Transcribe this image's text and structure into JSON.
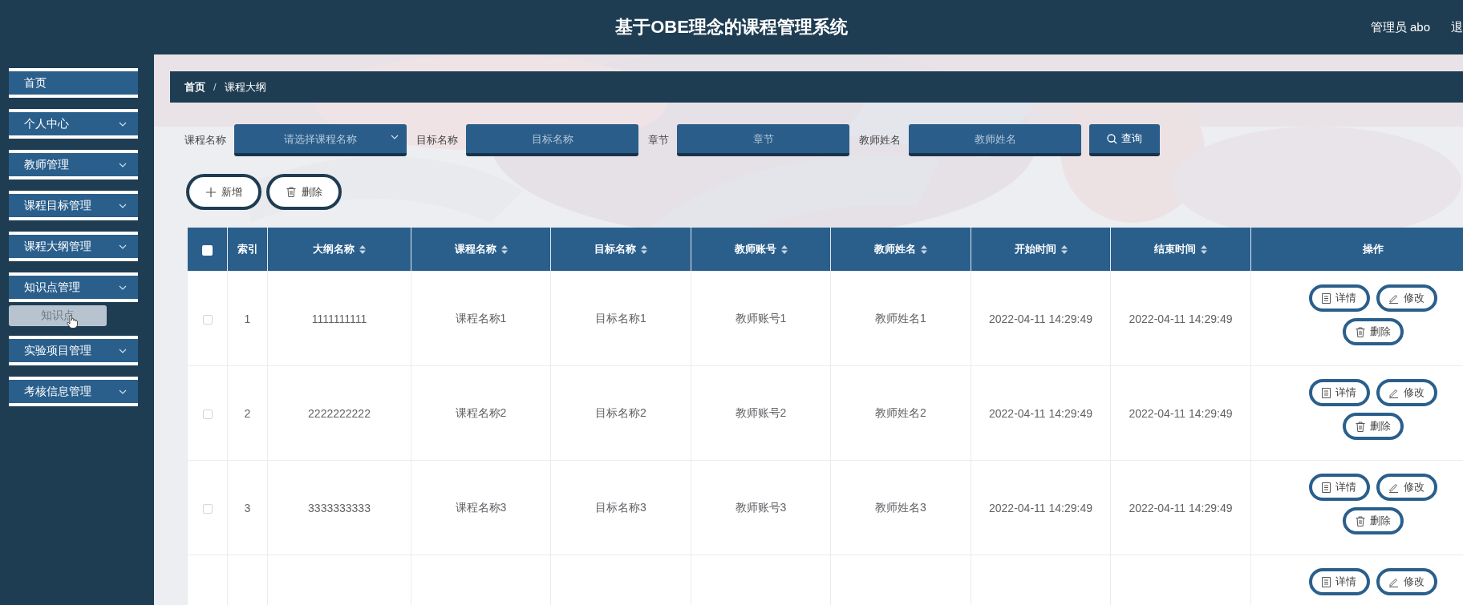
{
  "header": {
    "title": "基于OBE理念的课程管理系统",
    "user": "管理员 abo",
    "logout": "退"
  },
  "sidebar": {
    "items": [
      {
        "label": "首页",
        "kind": "link"
      },
      {
        "label": "个人中心",
        "kind": "menu"
      },
      {
        "label": "教师管理",
        "kind": "menu"
      },
      {
        "label": "课程目标管理",
        "kind": "menu"
      },
      {
        "label": "课程大纲管理",
        "kind": "menu"
      },
      {
        "label": "知识点管理",
        "kind": "menu",
        "children": [
          {
            "label": "知识点"
          }
        ]
      },
      {
        "label": "实验项目管理",
        "kind": "menu"
      },
      {
        "label": "考核信息管理",
        "kind": "menu"
      }
    ]
  },
  "breadcrumb": {
    "items": [
      "首页",
      "课程大纲"
    ],
    "separator": "/"
  },
  "search": {
    "fields": [
      {
        "label": "课程名称",
        "kind": "select",
        "placeholder": "请选择课程名称"
      },
      {
        "label": "目标名称",
        "kind": "input",
        "placeholder": "目标名称"
      },
      {
        "label": "章节",
        "kind": "input",
        "placeholder": "章节"
      },
      {
        "label": "教师姓名",
        "kind": "input",
        "placeholder": "教师姓名"
      }
    ],
    "button": "查询"
  },
  "actions": [
    {
      "label": "新增",
      "kind": "add"
    },
    {
      "label": "删除",
      "kind": "delete"
    }
  ],
  "table": {
    "header_checked": false,
    "columns": [
      {
        "label": "索引",
        "sortable": false
      },
      {
        "label": "大纲名称",
        "sortable": true
      },
      {
        "label": "课程名称",
        "sortable": true
      },
      {
        "label": "目标名称",
        "sortable": true
      },
      {
        "label": "教师账号",
        "sortable": true
      },
      {
        "label": "教师姓名",
        "sortable": true
      },
      {
        "label": "开始时间",
        "sortable": true
      },
      {
        "label": "结束时间",
        "sortable": true
      },
      {
        "label": "操作",
        "sortable": false
      }
    ],
    "rows": [
      {
        "checked": false,
        "cells": [
          "1",
          "1111111111",
          "课程名称1",
          "目标名称1",
          "教师账号1",
          "教师姓名1",
          "2022-04-11 14:29:49",
          "2022-04-11 14:29:49"
        ],
        "actions": [
          {
            "label": "详情",
            "kind": "detail"
          },
          {
            "label": "修改",
            "kind": "edit"
          },
          {
            "label": "删除",
            "kind": "delete"
          }
        ]
      },
      {
        "checked": false,
        "cells": [
          "2",
          "2222222222",
          "课程名称2",
          "目标名称2",
          "教师账号2",
          "教师姓名2",
          "2022-04-11 14:29:49",
          "2022-04-11 14:29:49"
        ],
        "actions": [
          {
            "label": "详情",
            "kind": "detail"
          },
          {
            "label": "修改",
            "kind": "edit"
          },
          {
            "label": "删除",
            "kind": "delete"
          }
        ]
      },
      {
        "checked": false,
        "cells": [
          "3",
          "3333333333",
          "课程名称3",
          "目标名称3",
          "教师账号3",
          "教师姓名3",
          "2022-04-11 14:29:49",
          "2022-04-11 14:29:49"
        ],
        "actions": [
          {
            "label": "详情",
            "kind": "detail"
          },
          {
            "label": "修改",
            "kind": "edit"
          },
          {
            "label": "删除",
            "kind": "delete"
          }
        ]
      },
      {
        "actions": [
          {
            "label": "详情",
            "kind": "detail"
          },
          {
            "label": "修改",
            "kind": "edit"
          }
        ]
      }
    ]
  }
}
